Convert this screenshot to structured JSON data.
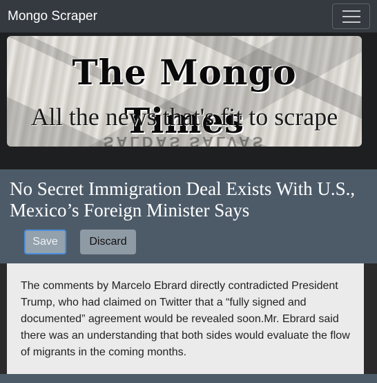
{
  "navbar": {
    "brand": "Mongo Scraper",
    "toggler_icon": "hamburger-menu-icon"
  },
  "banner": {
    "title": "The Mongo Times",
    "subtitle": "All the news that's fit to scrape"
  },
  "article": {
    "headline": "No Secret Immigration Deal Exists With U.S., Mexico’s Foreign Minister Says",
    "save_label": "Save",
    "discard_label": "Discard",
    "summary": "The comments by Marcelo Ebrard directly contradicted President Trump, who had claimed on Twitter that a “fully signed and documented” agreement would be revealed soon.Mr. Ebrard said there was an understanding that both sides would evaluate the flow of migrants in the coming months."
  },
  "colors": {
    "navbar_bg": "#343a40",
    "card_bg": "#4d5b69",
    "summary_bg": "#ebebeb",
    "save_border": "#4a8ee0"
  }
}
